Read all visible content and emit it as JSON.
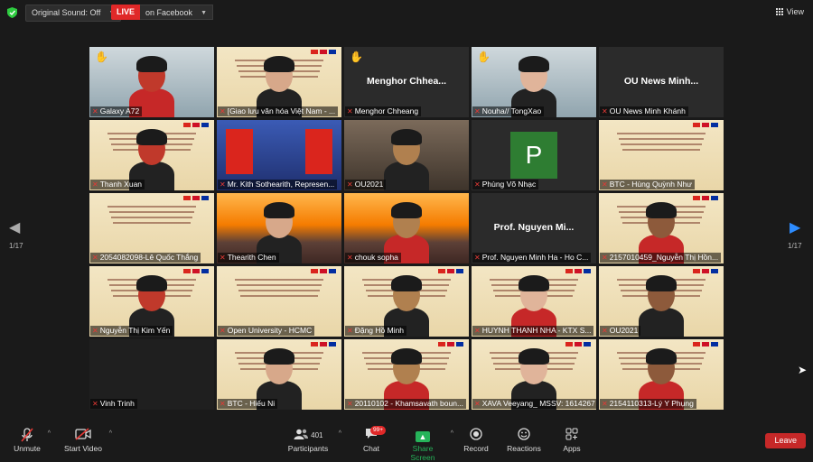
{
  "topbar": {
    "sound_label": "Original Sound: Off",
    "live_badge": "LIVE",
    "live_text": "on Facebook",
    "view_label": "View"
  },
  "pagination": {
    "left": "1/17",
    "right": "1/17"
  },
  "tiles": [
    {
      "name": "Galaxy A72",
      "type": "person",
      "hand": true,
      "big_name": ""
    },
    {
      "name": "[Giao lưu văn hóa Việt Nam - ...",
      "type": "person-slide",
      "hand": false,
      "big_name": ""
    },
    {
      "name": "Menghor Chheang",
      "type": "name",
      "hand": true,
      "big_name": "Menghor  Chhea..."
    },
    {
      "name": "Nouha// TongXao",
      "type": "person",
      "hand": true,
      "big_name": ""
    },
    {
      "name": "OU News Minh Khánh",
      "type": "name",
      "hand": false,
      "big_name": "OU News Minh..."
    },
    {
      "name": "Thanh Xuan",
      "type": "person-slide",
      "hand": false,
      "big_name": "",
      "active": true
    },
    {
      "name": "Mr. Kith Sothearith, Represen...",
      "type": "flags",
      "hand": false,
      "big_name": ""
    },
    {
      "name": "OU2021",
      "type": "room",
      "hand": false,
      "big_name": ""
    },
    {
      "name": "Phùng Võ Nhạc",
      "type": "avatar",
      "hand": false,
      "big_name": "",
      "avatar": "P"
    },
    {
      "name": "BTC - Hùng Quỳnh Như",
      "type": "slide",
      "hand": false,
      "big_name": ""
    },
    {
      "name": "2054082098-Lê Quốc Thắng",
      "type": "slide",
      "hand": false,
      "big_name": ""
    },
    {
      "name": "Thearith Chen",
      "type": "temple",
      "hand": false,
      "big_name": ""
    },
    {
      "name": "chouk sopha",
      "type": "temple-person",
      "hand": false,
      "big_name": ""
    },
    {
      "name": "Prof. Nguyen Minh Ha - Ho C...",
      "type": "name",
      "hand": false,
      "big_name": "Prof.  Nguyen  Mi..."
    },
    {
      "name": "2157010459_Nguyễn Thị Hồn...",
      "type": "person-slide",
      "hand": false,
      "big_name": ""
    },
    {
      "name": "Nguyễn Thị Kim Yến",
      "type": "person-slide",
      "hand": false,
      "big_name": ""
    },
    {
      "name": "Open University  - HCMC",
      "type": "slide",
      "hand": false,
      "big_name": ""
    },
    {
      "name": "Đặng Hồ Minh",
      "type": "person-slide",
      "hand": false,
      "big_name": ""
    },
    {
      "name": "HUYNH THANH NHA - KTX S...",
      "type": "person-slide",
      "hand": false,
      "big_name": ""
    },
    {
      "name": "OU2021",
      "type": "person-slide",
      "hand": false,
      "big_name": ""
    },
    {
      "name": "Vinh Trinh",
      "type": "blank",
      "hand": false,
      "big_name": ""
    },
    {
      "name": "BTC - Hiếu Ni",
      "type": "person-slide",
      "hand": false,
      "big_name": ""
    },
    {
      "name": "20110102 - Khamsavath boun...",
      "type": "person-slide",
      "hand": false,
      "big_name": ""
    },
    {
      "name": "XAVA Veeyang_ MSSV: 1614267",
      "type": "person-slide",
      "hand": false,
      "big_name": ""
    },
    {
      "name": "2154110313-Lý Y Phụng",
      "type": "person-slide",
      "hand": false,
      "big_name": ""
    }
  ],
  "toolbar": {
    "unmute": "Unmute",
    "start_video": "Start Video",
    "participants": "Participants",
    "participants_count": "401",
    "chat": "Chat",
    "chat_badge": "99+",
    "share_screen": "Share Screen",
    "record": "Record",
    "reactions": "Reactions",
    "apps": "Apps",
    "leave": "Leave"
  }
}
